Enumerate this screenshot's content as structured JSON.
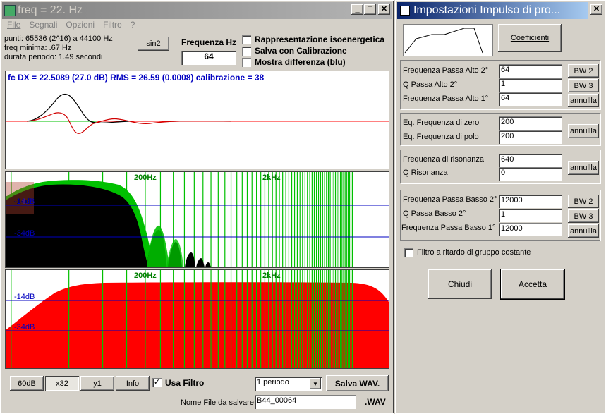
{
  "main_window": {
    "title": "freq = 22. Hz",
    "menu": [
      "File",
      "Segnali",
      "Opzioni",
      "Filtro",
      "?"
    ],
    "info": {
      "points": "punti: 65536 (2^16) a 44100 Hz",
      "min_freq": "freq minima: .67 Hz",
      "period": "durata periodo: 1.49 secondi"
    },
    "sin2_button": "sin2",
    "freq_label": "Frequenza Hz",
    "freq_value": "64",
    "checkboxes": [
      {
        "label": "Rappresentazione isoenergetica",
        "checked": false
      },
      {
        "label": "Salva con Calibrazione",
        "checked": false
      },
      {
        "label": "Mostra differenza (blu)",
        "checked": false
      }
    ],
    "plot1": {
      "caption": "fc DX = 22.5089 (27.0 dB) RMS = 26.59 (0.0008)  calibrazione = 38"
    },
    "plot2": {
      "labels": {
        "f1": "200Hz",
        "f2": "2kHz",
        "db1": "-14dB",
        "db2": "-34dB"
      }
    },
    "plot3": {
      "labels": {
        "f1": "200Hz",
        "f2": "2kHz",
        "db1": "-14dB",
        "db2": "-34dB"
      }
    },
    "buttons": {
      "b60db": "60dB",
      "x32": "x32",
      "y1": "y1",
      "info": "Info",
      "save_wav": "Salva WAV."
    },
    "usa_filtro": {
      "label": "Usa Filtro",
      "checked": true
    },
    "period_select": "1 periodo",
    "file_label": "Nome File da salvare",
    "file_value": "B44_00064",
    "file_ext": ".WAV"
  },
  "dialog": {
    "title": "Impostazioni Impulso di pro...",
    "coeff_button": "Coefficienti",
    "groups": [
      {
        "rows": [
          {
            "label": "Frequenza Passa Alto 2°",
            "value": "64"
          },
          {
            "label": "Q Passa Alto 2°",
            "value": "1"
          },
          {
            "label": "Frequenza Passa Alto 1°",
            "value": "64"
          }
        ],
        "buttons": [
          "BW 2",
          "BW 3",
          "annullla"
        ]
      },
      {
        "rows": [
          {
            "label": "Eq. Frequenza di zero",
            "value": "200"
          },
          {
            "label": "Eq. Frequenza di polo",
            "value": "200"
          }
        ],
        "buttons": [
          "annullla"
        ]
      },
      {
        "rows": [
          {
            "label": "Frequenza di risonanza",
            "value": "640"
          },
          {
            "label": "Q Risonanza",
            "value": "0"
          }
        ],
        "buttons": [
          "annullla"
        ]
      },
      {
        "rows": [
          {
            "label": "Frequenza Passa Basso 2°",
            "value": "12000"
          },
          {
            "label": "Q Passa Basso 2°",
            "value": "1"
          },
          {
            "label": "Frequenza Passa Basso 1°",
            "value": "12000"
          }
        ],
        "buttons": [
          "BW 2",
          "BW 3",
          "annullla"
        ]
      }
    ],
    "group_delay": {
      "label": "Filtro a ritardo di gruppo costante",
      "checked": false
    },
    "close_button": "Chiudi",
    "accept_button": "Accetta"
  },
  "colors": {
    "title_active": "#0a246a",
    "title_inactive": "#808080",
    "caption_blue": "#0000c0",
    "green": "#00c000",
    "red": "#ff0000",
    "black": "#000000"
  }
}
